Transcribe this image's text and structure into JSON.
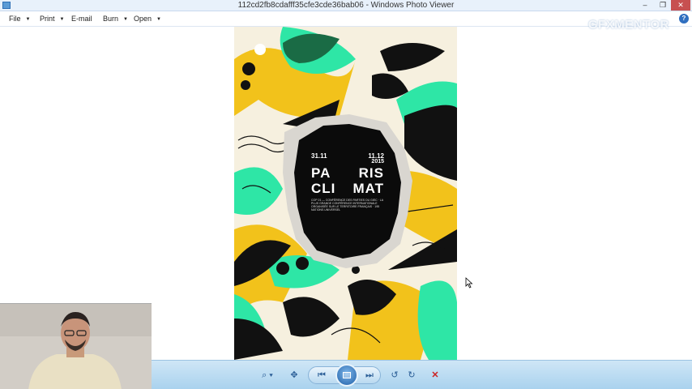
{
  "window": {
    "title": "112cd2fb8cdafff35cfe3cde36bab06 - Windows Photo Viewer",
    "controls": {
      "minimize": "–",
      "restore": "❐",
      "close": "✕"
    }
  },
  "menu": {
    "items": [
      {
        "label": "File",
        "caret": "▼"
      },
      {
        "label": "Print",
        "caret": "▼"
      },
      {
        "label": "E-mail"
      },
      {
        "label": "Burn",
        "caret": "▼"
      },
      {
        "label": "Open",
        "caret": "▼"
      }
    ],
    "help": "?"
  },
  "watermark": {
    "part1": "GFX",
    "part2": "MENTOR"
  },
  "poster": {
    "date_start": "31.11",
    "date_end": "11.12",
    "year": "2015",
    "line1a": "PA",
    "line2": "RIS",
    "line3a": "CLI",
    "line3b": "MAT",
    "fine_print": "COP 21 — CONFÉRENCE DES PARTIES DU GIEC · LA PLUS GRANDE CONFÉRENCE INTERNATIONALE ORGANISÉE SUR LE TERRITOIRE FRANÇAIS · 195 NATIONS UNIVERSEL"
  },
  "toolbar": {
    "zoom": "⌕ ▾",
    "actual_size": "✥",
    "previous": "⏮",
    "next": "⏭",
    "rotate_ccw": "↺",
    "rotate_cw": "↻",
    "delete": "✕"
  },
  "colors": {
    "accent_yellow": "#f2c21b",
    "accent_green": "#2ee6a6",
    "toolbar_blue": "#b4d9f2",
    "close_red": "#c75050"
  }
}
